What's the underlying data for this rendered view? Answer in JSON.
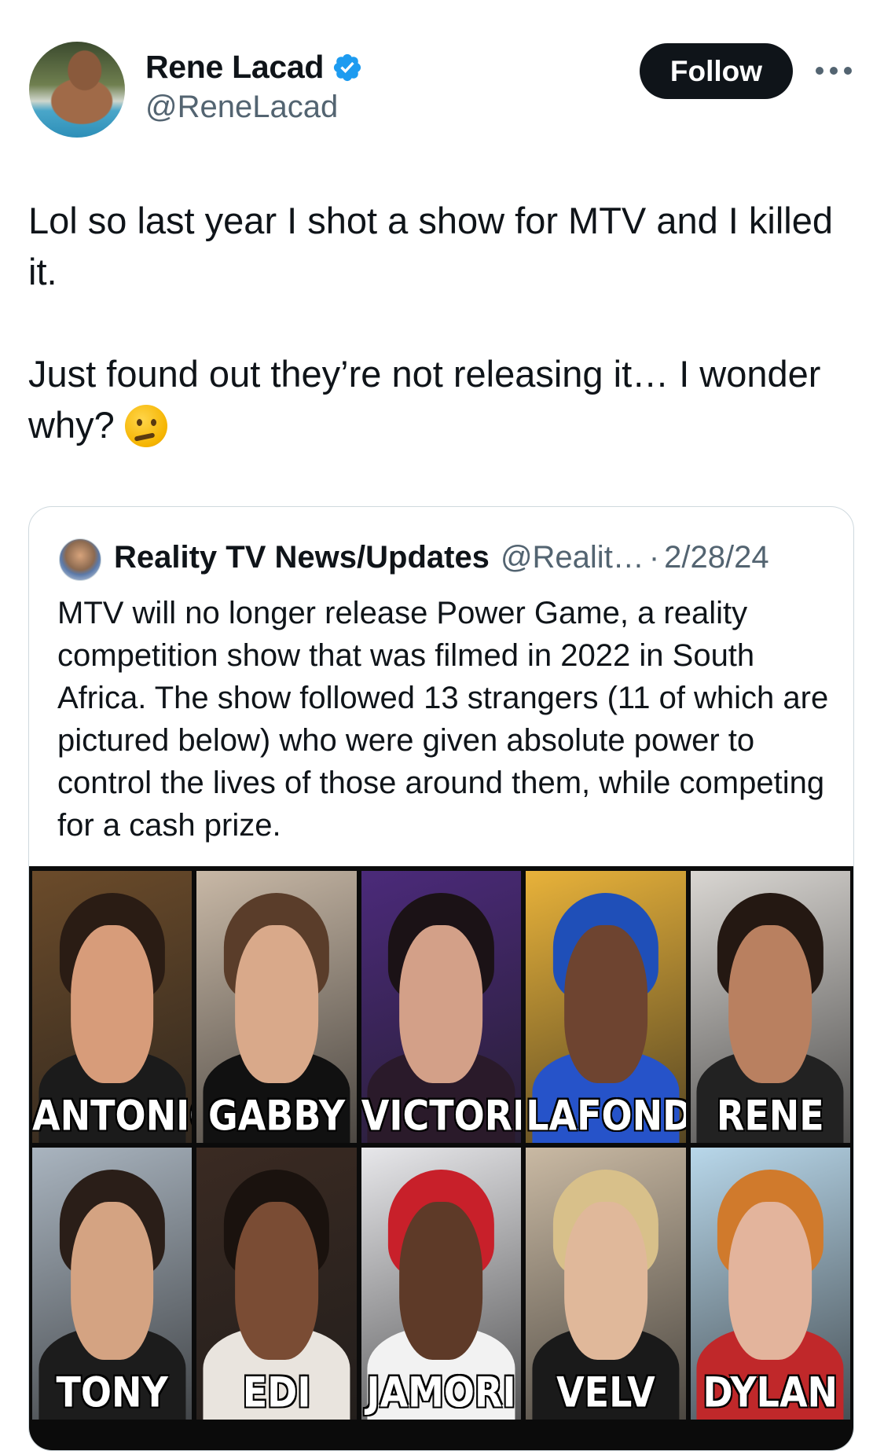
{
  "author": {
    "display_name": "Rene Lacad",
    "handle": "@ReneLacad",
    "verified": true
  },
  "actions": {
    "follow_label": "Follow",
    "more_icon": "more-horizontal-icon"
  },
  "tweet": {
    "text": "Lol so last year I shot a show for MTV and I killed it.\n\nJust found out they’re not releasing it… I wonder why? ",
    "emoji": "thinking-face-icon"
  },
  "quote": {
    "name": "Reality TV News/Updates",
    "handle": "@Realit…",
    "separator": "·",
    "date": "2/28/24",
    "text": "MTV will no longer release Power Game, a reality competition show that was filmed in 2022 in South Africa. The show followed 13 strangers (11 of which are pictured below) who were given absolute power to control the lives of those around them, while competing for a cash prize.",
    "cast": [
      {
        "name": "ANTONIO",
        "bg": "#6b4b2a",
        "skin": "#d79c7a",
        "hair": "#2a1c14",
        "top": "#1b1b1b"
      },
      {
        "name": "GABBY",
        "bg": "#c8b8a6",
        "skin": "#d9a98a",
        "hair": "#5a3d2a",
        "top": "#111111"
      },
      {
        "name": "VICTORIA",
        "bg": "#4b2a7a",
        "skin": "#d3a088",
        "hair": "#1b1216",
        "top": "#2a1a2a"
      },
      {
        "name": "LAFONDA",
        "bg": "#e8b23a",
        "skin": "#6e4430",
        "hair": "#1f4fb8",
        "top": "#2653c9"
      },
      {
        "name": "RENE",
        "bg": "#d9d6d2",
        "skin": "#b98060",
        "hair": "#241812",
        "top": "#222222"
      },
      {
        "name": "TONY",
        "bg": "#a9b4bf",
        "skin": "#d4a382",
        "hair": "#2a1e18",
        "top": "#1c1c1c"
      },
      {
        "name": "EDI",
        "bg": "#3a2a22",
        "skin": "#7a4c34",
        "hair": "#1a120e",
        "top": "#e9e4de"
      },
      {
        "name": "JAMORI",
        "bg": "#e7e7ea",
        "skin": "#5e3a28",
        "hair": "#c8202a",
        "top": "#f2f2f2"
      },
      {
        "name": "VELV",
        "bg": "#c9b9a3",
        "skin": "#e0b89a",
        "hair": "#d8c08a",
        "top": "#1a1a1a"
      },
      {
        "name": "DYLAN",
        "bg": "#b8d7ea",
        "skin": "#e3b49c",
        "hair": "#d07a2c",
        "top": "#c0282a"
      }
    ]
  }
}
